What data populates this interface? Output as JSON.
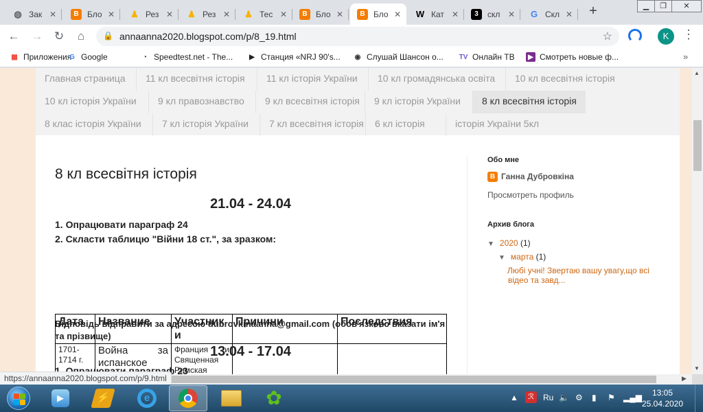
{
  "browser": {
    "tabs": [
      {
        "title": "Зак",
        "icon": "globe-icon",
        "color": "#5f6368"
      },
      {
        "title": "Бло",
        "icon": "blogger-icon",
        "color": "#f57d00"
      },
      {
        "title": "Рез",
        "icon": "bell-icon",
        "color": "#f4b400"
      },
      {
        "title": "Рез",
        "icon": "bell-icon",
        "color": "#f4b400"
      },
      {
        "title": "Тес",
        "icon": "bell-icon",
        "color": "#f4b400"
      },
      {
        "title": "Бло",
        "icon": "blogger-icon",
        "color": "#f57d00"
      },
      {
        "title": "Бло",
        "icon": "blogger-icon",
        "color": "#f57d00",
        "active": true
      },
      {
        "title": "Кат",
        "icon": "wikipedia-icon",
        "color": "#000000"
      },
      {
        "title": "скл",
        "icon": "three-icon",
        "color": "#000000"
      },
      {
        "title": "Скл",
        "icon": "google-icon",
        "color": "#4285f4"
      }
    ],
    "url": "annaanna2020.blogspot.com/p/8_19.html",
    "profile_initial": "K",
    "bookmarks": [
      {
        "label": "Приложения",
        "icon": "apps-grid-icon"
      },
      {
        "label": "Google",
        "icon": "google-icon"
      },
      {
        "label": "Speedtest.net - The...",
        "icon": "speedometer-icon"
      },
      {
        "label": "Станция «NRJ 90's...",
        "icon": "play-circle-icon"
      },
      {
        "label": "Слушай Шансон о...",
        "icon": "globe-icon"
      },
      {
        "label": "Онлайн ТВ",
        "icon": "tv-icon"
      },
      {
        "label": "Смотреть новые ф...",
        "icon": "video-icon"
      }
    ],
    "status_url": "https://annaanna2020.blogspot.com/p/9.html"
  },
  "nav": {
    "rows": [
      [
        "Главная страница",
        "11 кл всесвітня історія",
        "11 кл історія України",
        "10 кл громадянська освіта",
        "10 кл всесвітня історія"
      ],
      [
        "10 кл історія України",
        "9 кл правознавство",
        "9 кл всесвітня історія",
        "9 кл історія України",
        "8 кл всесвітня історія"
      ],
      [
        "8 клас історія України",
        "7 кл історія України",
        "7 кл всесвітня історія",
        "6 кл історія",
        "історія України 5кл"
      ]
    ],
    "active": "8 кл всесвітня історія"
  },
  "post": {
    "title": "8 кл всесвітня історія",
    "date1": "21.04 - 24.04",
    "task1": "1. Опрацювати параграф 24",
    "task2": "2. Скласти  таблицю \"Війни 18 ст.\", за зразком:",
    "table": {
      "headers": [
        "Дата",
        "Название",
        "Участник и",
        "Причини",
        "Последствия"
      ],
      "row": {
        "date": "1701-1714 г.",
        "name": "Война за испанское наследство",
        "participants": "Франция и Священная Римская империя",
        "causes": "",
        "consequences": ""
      }
    },
    "answer": "Відповідь відправити за адресою dubrovkinaanna@gmail.com (обов'язково вказати ім'я та прізвище)",
    "date2": "13.04 - 17.04",
    "task3": "1. Опрацювати параграф 23"
  },
  "sidebar": {
    "about_title": "Обо мне",
    "author": "Ганна Дубровкіна",
    "profile_link": "Просмотреть профиль",
    "archive_title": "Архив блога",
    "year": "2020",
    "year_count": "(1)",
    "month": "марта",
    "month_count": "(1)",
    "post_link": "Любі учні! Звертаю вашу увагу,що всі відео та завд..."
  },
  "taskbar": {
    "lang": "Ru",
    "time": "13:05",
    "date": "25.04.2020"
  }
}
